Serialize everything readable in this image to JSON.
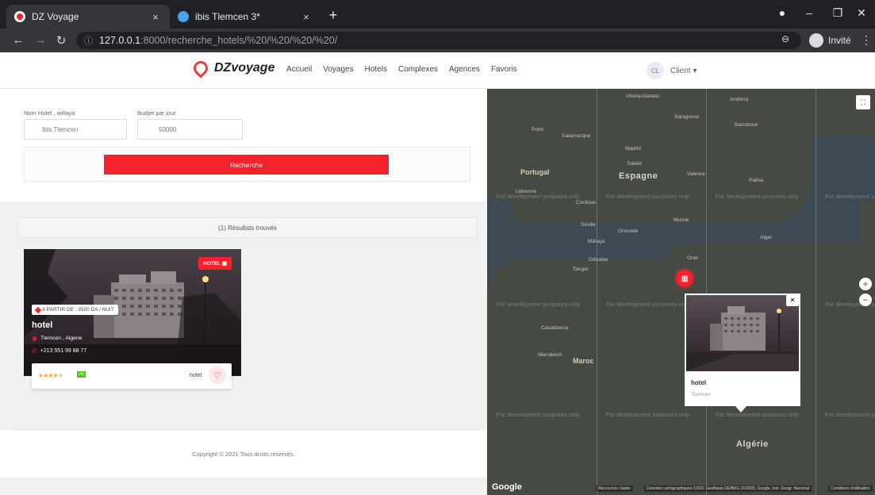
{
  "browser": {
    "tabs": [
      {
        "title": "DZ Voyage",
        "close": "×"
      },
      {
        "title": "ibis Tlemcen 3*",
        "close": "×"
      }
    ],
    "new_tab": "+",
    "url_host": "127.0.0.1",
    "url_rest": ":8000/recherche_hotels/%20/%20/%20/%20/",
    "profile": "Invité",
    "controls": {
      "minimize": "–",
      "restore": "❐",
      "close": "✕"
    }
  },
  "header": {
    "logo_text": "DZvoyage",
    "menu": [
      "Accueil",
      "Voyages",
      "Hotels",
      "Complexes",
      "Agences",
      "Favoris"
    ],
    "client_initials": "CL",
    "client_label": "Client ▾"
  },
  "search": {
    "name_label": "Nom Hotel , willaya",
    "name_value": "Ibis Tlemcen",
    "budget_label": "Budjet par jour",
    "budget_value": "50000",
    "button": "Recherche"
  },
  "results": {
    "count_text": "(1) Résultats trouvés"
  },
  "hotel_card": {
    "badge": "HOTEL",
    "price": "A PARTIR DE : 3500 DA / NUIT",
    "title": "hotel",
    "location": "Tlemcen , Algerie",
    "phone": "+213 551 99 88 77",
    "stars": 4,
    "rating_badge": "(4)",
    "type": "hotel"
  },
  "footer": {
    "copyright": "Copyright © 2021 Tous droits réservés."
  },
  "map": {
    "dev_text": "For development purposes only",
    "places": {
      "portugal": "Portugal",
      "espagne": "Espagne",
      "maroc": "Maroc",
      "algerie": "Algérie",
      "andorra": "Andorra",
      "saragosse": "Saragosse",
      "barcelone": "Barcelone",
      "madrid": "Madrid",
      "valence": "Valence",
      "palma": "Palma",
      "porto": "Porto",
      "lisbonne": "Lisbonne",
      "seville": "Séville",
      "malaga": "Málaga",
      "murcie": "Murcie",
      "grenade": "Grenade",
      "alger": "Alger",
      "oran": "Oran",
      "tanger": "Tanger",
      "gibraltar": "Gibraltar",
      "casablanca": "Casablanca",
      "marrakech": "Marrakech",
      "vitoria": "Vitoria-Gasteiz",
      "salamanque": "Salamanque",
      "toledo": "Tolède",
      "cordoue": "Cordoue"
    },
    "popup_title": "hotel",
    "popup_sub": "Tlemcen",
    "popup_close": "×",
    "google": "Google",
    "attr1": "Raccourcis clavier",
    "attr2": "Données cartographiques ©2021 GeoBasis-DE/BKG (©2009), Google, Inst. Geogr. Nacional",
    "attr3": "Conditions d'utilisation"
  },
  "colors": {
    "accent": "#f5222d",
    "star": "#f5a623",
    "rating": "#52c41a"
  }
}
